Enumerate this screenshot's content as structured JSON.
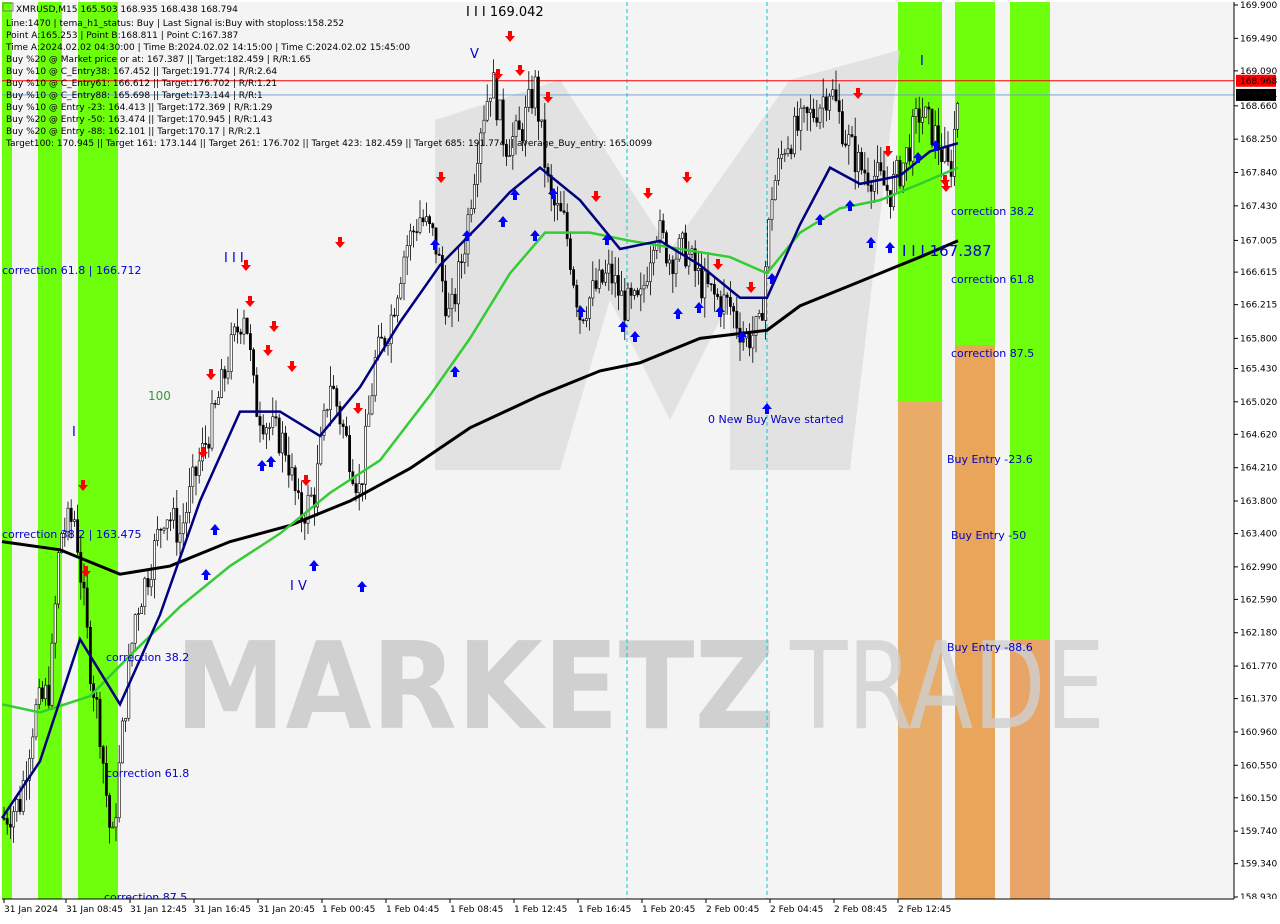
{
  "chart_data": {
    "type": "candlestick",
    "symbol_header": "XMRUSD,M15",
    "header_values": "165.503 168.935 168.438 168.794",
    "info_lines": [
      "Line:1470 | tema_h1_status: Buy | Last Signal is:Buy with stoploss:158.252",
      "Point A:165.253 | Point B:168.811 | Point C:167.387",
      "Time A:2024.02.02 04:30:00 | Time B:2024.02.02 14:15:00 | Time C:2024.02.02 15:45:00",
      "Buy %20 @ Market price or at: 167.387 || Target:182.459 | R/R:1.65",
      "Buy %10 @ C_Entry38: 167.452 || Target:191.774 | R/R:2.64",
      "Buy %10 @ C_Entry61: 166.612 || Target:176.702 | R/R:1.21",
      "Buy %10 @ C_Entry88: 165.698 || Target:173.144 | R/R:1",
      "Buy %10 @ Entry -23: 164.413 || Target:172.369 | R/R:1.29",
      "Buy %20 @ Entry -50: 163.474 || Target:170.945 | R/R:1.43",
      "Buy %20 @ Entry -88: 162.101 || Target:170.17 | R/R:2.1",
      "Target100: 170.945 || Target 161: 173.144 || Target 261: 176.702 || Target 423: 182.459 || Target 685: 191.774 || average_Buy_entry: 165.0099"
    ],
    "y_ticks": [
      "169.900",
      "169.490",
      "169.090",
      "168.660",
      "168.250",
      "167.840",
      "167.430",
      "167.005",
      "166.615",
      "166.215",
      "165.800",
      "165.430",
      "165.020",
      "164.620",
      "164.210",
      "163.800",
      "163.400",
      "162.990",
      "162.590",
      "162.180",
      "161.770",
      "161.370",
      "160.960",
      "160.550",
      "160.150",
      "159.740",
      "159.340",
      "158.930"
    ],
    "x_labels": [
      "31 Jan 2024",
      "31 Jan 08:45",
      "31 Jan 12:45",
      "31 Jan 16:45",
      "31 Jan 20:45",
      "1 Feb 00:45",
      "1 Feb 04:45",
      "1 Feb 08:45",
      "1 Feb 12:45",
      "1 Feb 16:45",
      "1 Feb 20:45",
      "2 Feb 00:45",
      "2 Feb 04:45",
      "2 Feb 08:45",
      "2 Feb 12:45"
    ],
    "ylim": [
      158.93,
      169.9
    ],
    "price_tags": [
      {
        "value": "168.968",
        "color": "#ff0000"
      },
      {
        "value": "168.794",
        "color": "#000000"
      }
    ],
    "annotations": [
      {
        "text": "I I I 169.042",
        "kind": "wave"
      },
      {
        "text": "V",
        "kind": "wave"
      },
      {
        "text": "I I I",
        "kind": "wave"
      },
      {
        "text": "I",
        "kind": "wave"
      },
      {
        "text": "I V",
        "kind": "wave"
      },
      {
        "text": "I",
        "kind": "wave"
      },
      {
        "text": "I I I 167.387",
        "kind": "wave"
      },
      {
        "text": "100",
        "kind": "label"
      },
      {
        "text": "correction 61.8 | 166.712",
        "kind": "level"
      },
      {
        "text": "correction 38.2 | 163.475",
        "kind": "level"
      },
      {
        "text": "correction 38.2",
        "kind": "level"
      },
      {
        "text": "correction 61.8",
        "kind": "level"
      },
      {
        "text": "correction 87.5",
        "kind": "level"
      },
      {
        "text": "0 New Buy Wave started",
        "kind": "label"
      },
      {
        "text": "correction 38.2",
        "kind": "level"
      },
      {
        "text": "correction 61.8",
        "kind": "level"
      },
      {
        "text": "correction 87.5",
        "kind": "level"
      },
      {
        "text": "Buy Entry -23.6",
        "kind": "level"
      },
      {
        "text": "Buy Entry -50",
        "kind": "level"
      },
      {
        "text": "Buy Entry -88.6",
        "kind": "level"
      }
    ],
    "watermark": "MARKETZ TRADE",
    "colors": {
      "green_band": "#66ff00",
      "orange_band": "#f0a050",
      "ema_dark": "#000080",
      "ema_green": "#33cc33",
      "sma_black": "#000000",
      "arrow_up": "#0000ff",
      "arrow_down": "#ff0000"
    }
  }
}
